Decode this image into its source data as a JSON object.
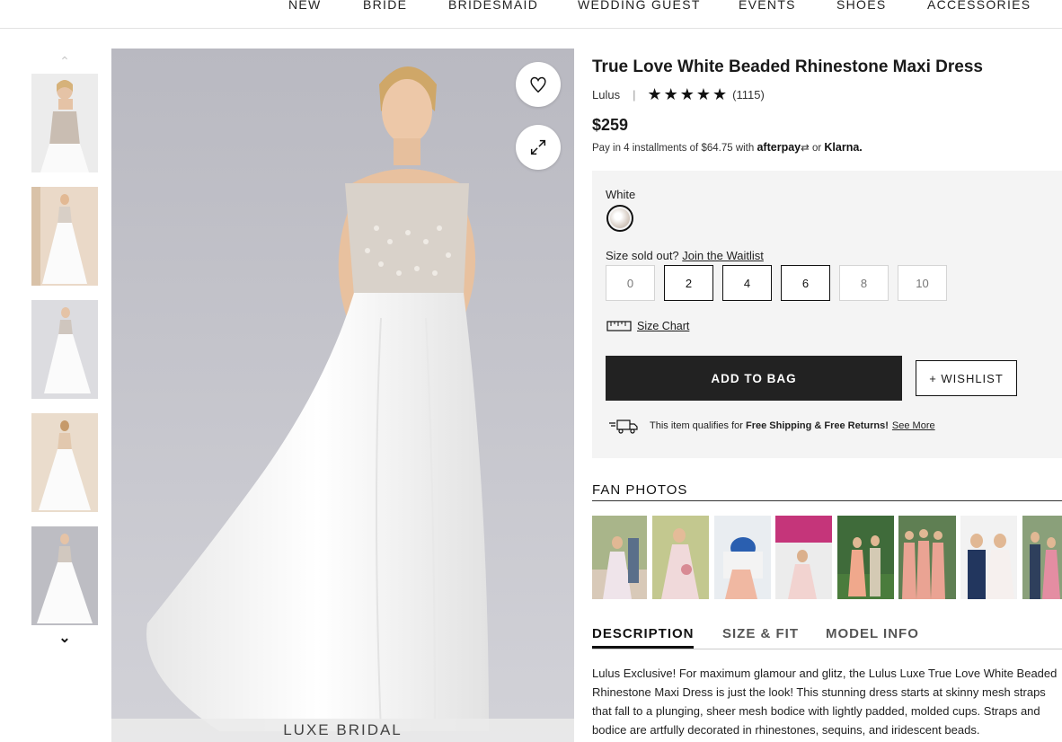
{
  "nav": [
    "NEW",
    "BRIDE",
    "BRIDESMAID",
    "WEDDING GUEST",
    "EVENTS",
    "SHOES",
    "ACCESSORIES"
  ],
  "product": {
    "title": "True Love White Beaded Rhinestone Maxi Dress",
    "brand": "Lulus",
    "rating": 5,
    "review_count": "(1115)",
    "price": "$259",
    "installments_prefix": "Pay in 4 installments of $64.75 with",
    "afterpay": "afterpay",
    "or": "or",
    "klarna": "Klarna."
  },
  "image": {
    "brand_bar": "LUXE BRIDAL"
  },
  "color": {
    "label": "White"
  },
  "sizes": {
    "help": "Size sold out?",
    "waitlist": "Join the Waitlist",
    "options": [
      {
        "label": "0",
        "available": false
      },
      {
        "label": "2",
        "available": true
      },
      {
        "label": "4",
        "available": true
      },
      {
        "label": "6",
        "available": true
      },
      {
        "label": "8",
        "available": false
      },
      {
        "label": "10",
        "available": false
      }
    ],
    "chart": "Size Chart"
  },
  "actions": {
    "add_to_bag": "ADD TO BAG",
    "wishlist": "+ WISHLIST"
  },
  "shipping": {
    "prefix": "This item qualifies for",
    "bold": "Free Shipping & Free Returns!",
    "see_more": "See More"
  },
  "fan_photos": {
    "title": "FAN PHOTOS"
  },
  "tabs": [
    "DESCRIPTION",
    "SIZE & FIT",
    "MODEL INFO"
  ],
  "description": "Lulus Exclusive! For maximum glamour and glitz, the Lulus Luxe True Love White Beaded Rhinestone Maxi Dress is just the look! This stunning dress starts at skinny mesh straps that fall to a plunging, sheer mesh bodice with lightly padded, molded cups. Straps and bodice are artfully decorated in rhinestones, sequins, and iridescent beads.",
  "colors": {
    "accent": "#222222",
    "panel": "#f4f4f4"
  }
}
